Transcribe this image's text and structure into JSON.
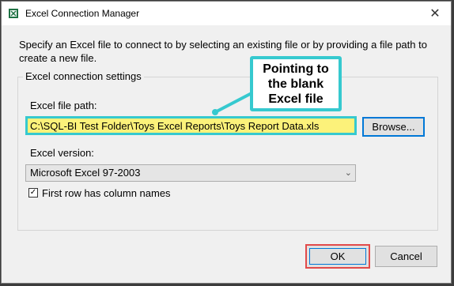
{
  "window": {
    "title": "Excel Connection Manager",
    "close_symbol": "✕"
  },
  "description": "Specify an Excel file to connect to by selecting an existing file or by providing a file path to create a new file.",
  "settings": {
    "group_label": "Excel connection settings",
    "file_path_label": "Excel file path:",
    "file_path_value": "C:\\SQL-BI Test Folder\\Toys Excel Reports\\Toys Report Data.xls",
    "browse_label": "Browse...",
    "version_label": "Excel version:",
    "version_value": "Microsoft Excel 97-2003",
    "first_row_label": "First row has column names",
    "first_row_checked": "✓"
  },
  "buttons": {
    "ok": "OK",
    "cancel": "Cancel"
  },
  "annotation": {
    "text": "Pointing to\nthe blank\nExcel file",
    "color": "#36c9cf",
    "highlight_color": "#fcf27a",
    "ok_outline_color": "#e24a4a"
  }
}
